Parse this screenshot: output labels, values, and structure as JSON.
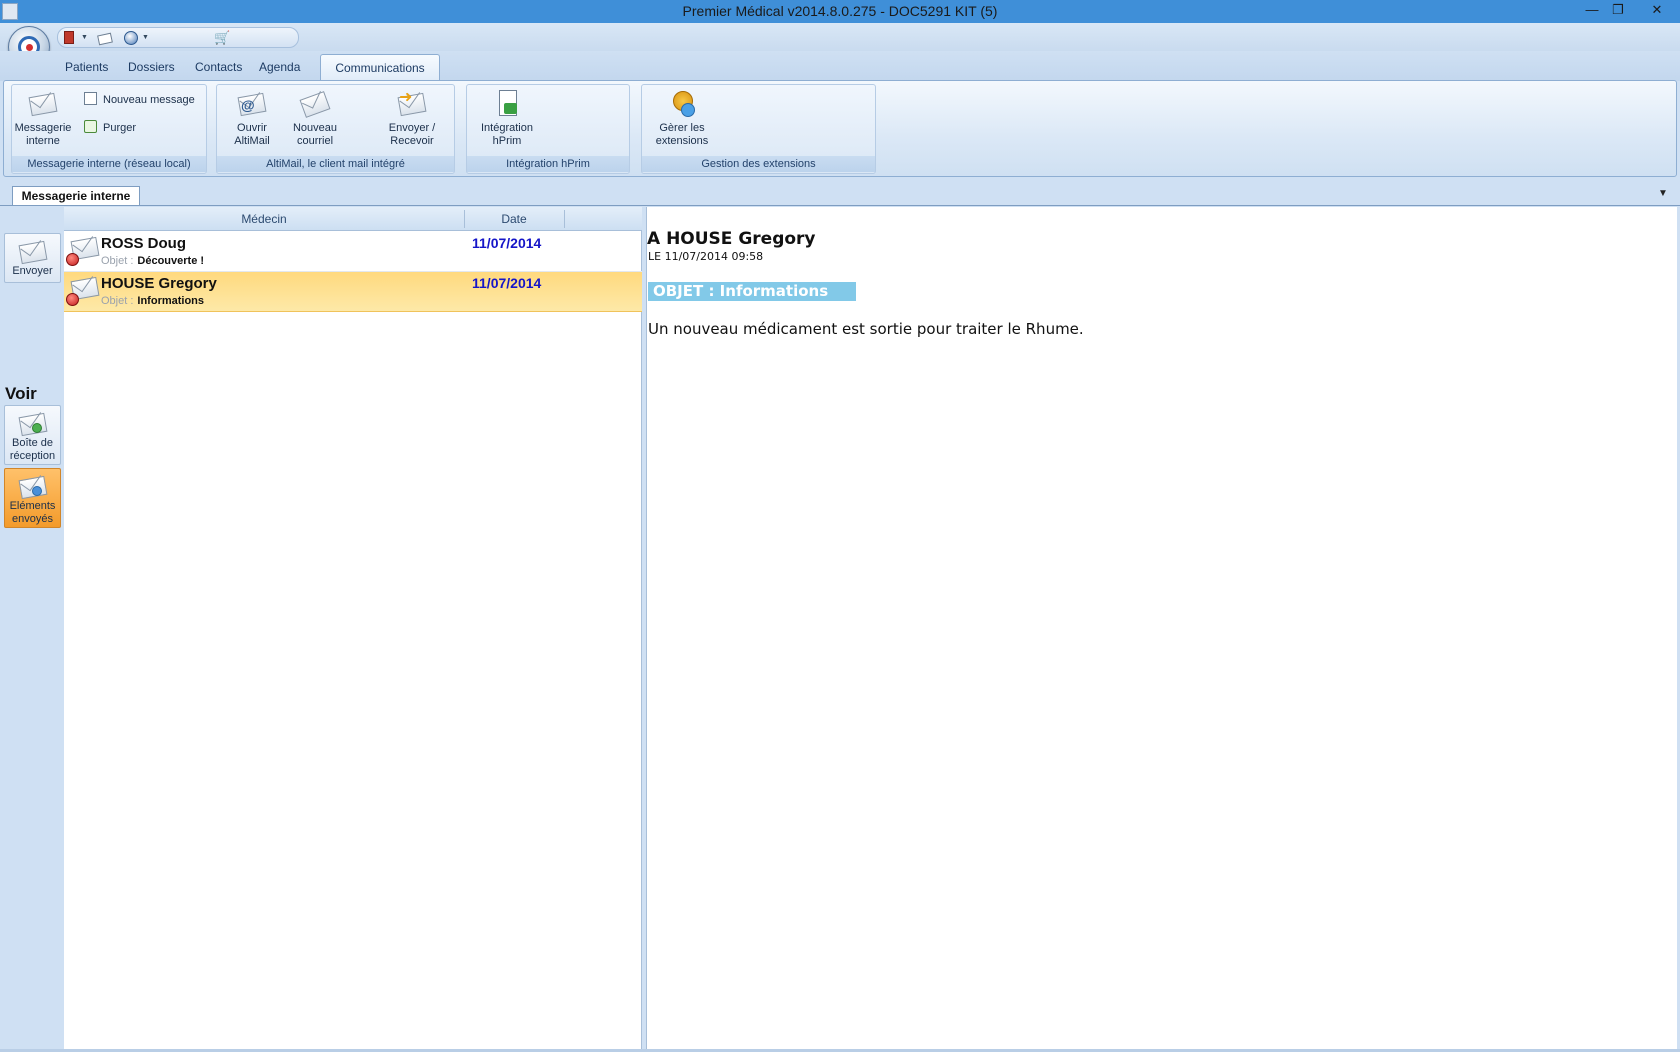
{
  "window": {
    "title": "Premier Médical v2014.8.0.275 - DOC5291 KIT (5)",
    "min_glyph": "—",
    "max_glyph": "❐",
    "close_glyph": "✕"
  },
  "quick_access": {
    "icons": [
      "book-icon",
      "envelope-icon",
      "globe-icon",
      "cart-icon"
    ]
  },
  "ribbon_tabs": [
    "Patients",
    "Dossiers",
    "Contacts",
    "Agenda",
    "Communications"
  ],
  "active_tab": "Communications",
  "ribbon_groups": {
    "messagerie": {
      "label": "Messagerie interne (réseau local)",
      "big_button": "Messagerie interne",
      "new_message": "Nouveau message",
      "purge": "Purger"
    },
    "altimail": {
      "label": "AltiMail, le client mail intégré",
      "open": "Ouvrir AltiMail",
      "new_mail": "Nouveau courriel",
      "send_receive": "Envoyer / Recevoir"
    },
    "hprim": {
      "label": "Intégration hPrim",
      "button": "Intégration hPrim"
    },
    "extensions": {
      "label": "Gestion des extensions",
      "button": "Gèrer les extensions"
    }
  },
  "document_tab": "Messagerie interne",
  "left_nav": {
    "send": "Envoyer",
    "section": "Voir",
    "inbox": "Boîte de réception",
    "sent": "Eléments envoyés"
  },
  "list": {
    "columns": [
      "Médecin",
      "Date"
    ],
    "object_label": "Objet :",
    "rows": [
      {
        "sender": "ROSS Doug",
        "date": "11/07/2014",
        "subject": "Découverte !",
        "selected": false
      },
      {
        "sender": "HOUSE Gregory",
        "date": "11/07/2014",
        "subject": "Informations",
        "selected": true
      }
    ]
  },
  "preview": {
    "to": "A HOUSE Gregory",
    "datetime": "LE 11/07/2014 09:58",
    "subject": "OBJET : Informations",
    "body": "Un nouveau médicament est sortie pour traiter le Rhume."
  },
  "colors": {
    "titlebar": "#3f8fd8",
    "ribbon_bg": "#cfe0f3",
    "selected_row": "#ffd97e",
    "date_text": "#1515c8",
    "subject_bar": "#82c9e8",
    "sent_button": "#f39b2b"
  }
}
